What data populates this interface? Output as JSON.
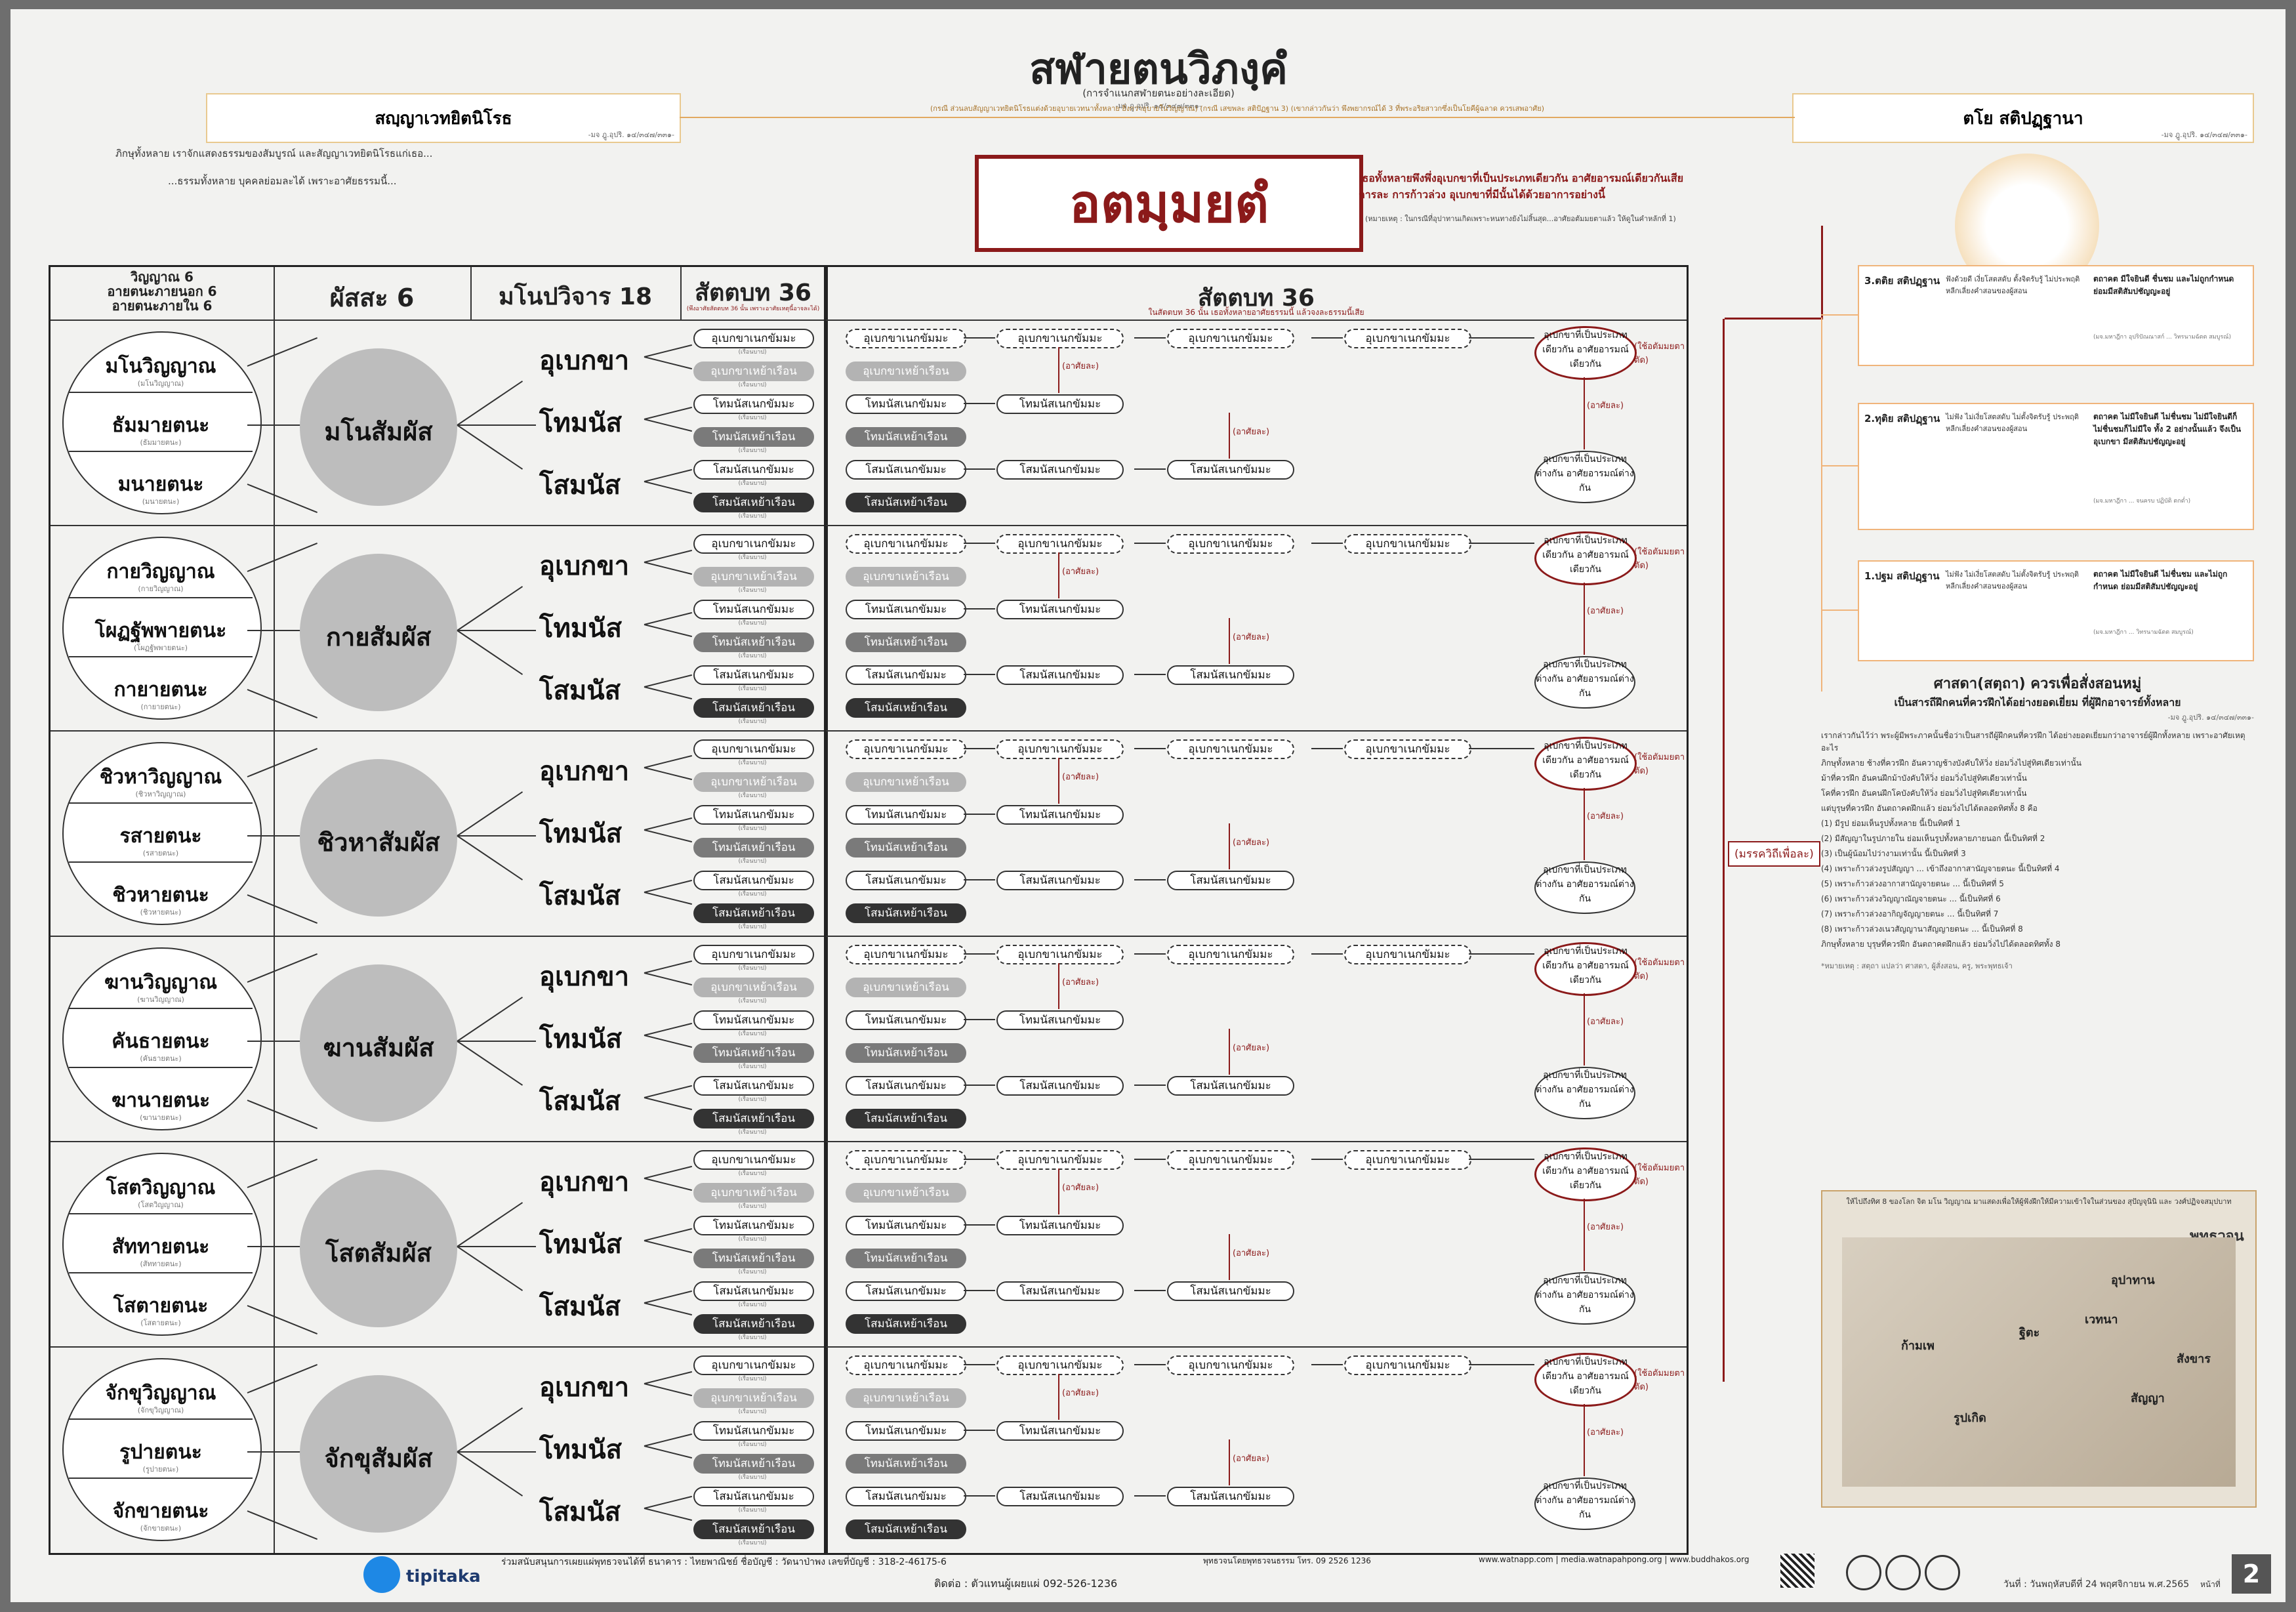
{
  "title": "สฬายตนวิภงฺคํ",
  "subtitle": "(การจำแนกสฬายตนะอย่างละเอียด)",
  "ref": "-มจ ฎู.อุปริ. ๑๔/๓๔๗/๓๓๑-",
  "hdr_left": {
    "title": "สญฺญาเวทยิตนิโรธ",
    "ref": "-มจ ฎู.อุปริ. ๑๔/๓๔๗/๓๓๑-"
  },
  "hdr_right": {
    "title": "ตโย สติปฏฺฐานา",
    "ref": "-มจ ฎู.อุปริ. ๑๔/๓๔๗/๓๓๑-"
  },
  "hdr_mid_text": "(กรณี ส่วนลบสัญญาเวทยิตนิโรธแต่งด้วยอุบายเวทนาทั้งหลาย ยิ่งกว่าอุบายในวิญญาณ) (กรณี เสขพละ สติปัฏฐาน 3) (เขากล่าวกันว่า พึงพยากรณ์ได้ 3 ที่พระอริยสาวกซึ่งเป็นโยคีผู้ฉลาด ควรเสพอาศัย)",
  "left_text_1": "ภิกษุทั้งหลาย เราจักแสดงธรรมของสัมบูรณ์ และสัญญาเวทยิตนิโรธแก่เธอ...",
  "left_text_2": "...ธรรมทั้งหลาย บุคคลย่อมละได้ เพราะอาศัยธรรมนี้...",
  "big_title": "อตมฺมยตํ",
  "red_note": "เธอทั้งหลายพึงพึ่งอุเบกขาที่เป็นประเภทเดียวกัน อาศัยอารมณ์เดียวกันเสีย การละ การก้าวล่วง อุเบกขาที่มีนั้นได้ด้วยอาการอย่างนี้",
  "note_small": "(หมายเหตุ : ในกรณีที่อุปาทานเกิดเพราะหนทางยังไม่สิ้นสุด...อาศัยอตัมมยตาแล้ว ให้ดูในคำหลักที่ 1)",
  "lt_headers": {
    "c1a": "วิญญาณ 6",
    "c1b": "อายตนะภายนอก 6",
    "c1c": "อายตนะภายใน 6",
    "c2": "ผัสสะ 6",
    "c3": "มโนปวิจาร 18",
    "c4": "สัตตบท 36",
    "c4_sub": "(พึงอาศัยสัตตบท 36 นั้น เพราะอาศัยเหตุนี้อาจละได้)"
  },
  "rt_header": "สัตตบท 36",
  "rt_header_sub": "ในสัตตบท 36 นั้น เธอทั้งหลายอาศัยธรรมนี้ แล้วจงละธรรมนี้เสีย",
  "vicara": [
    "อุเบกขา",
    "โทมนัส",
    "โสมนัส"
  ],
  "pills_left": [
    "อุเบกขาเนกขัมมะ",
    "อุเบกขาเหย้าเรือน",
    "โทมนัสเนกขัมมะ",
    "โทมนัสเหย้าเรือน",
    "โสมนัสเนกขัมมะ",
    "โสมนัสเหย้าเรือน"
  ],
  "pill_sub": "(เรือนบาป)",
  "group_labels": {
    "pure": "(อริยปุถุชน)",
    "attach": "(อาศัยละ)"
  },
  "chain": {
    "u1": "อุเบกขาเนกขัมมะ",
    "u2": "อุเบกขาเนกขัมมะ",
    "u3": "อุเบกขาเนกขัมมะ",
    "d": "โทมนัสเนกขัมมะ",
    "s1": "โสมนัสเนกขัมมะ",
    "s2": "โสมนัสเนกขัมมะ",
    "red_top": "อุเบกขาที่เป็นประเภทเดียวกัน อาศัยอารมณ์เดียวกัน",
    "red_bot": "อุเบกขาที่เป็นประเภทต่างกัน อาศัยอารมณ์ต่างกัน",
    "red_label": "(ใช้อตัมมยตาตัด)"
  },
  "marga_label": "(มรรควิถีเพื่อละ)",
  "rows": [
    {
      "sense": [
        "มโนวิญญาณ",
        "ธัมมายตนะ",
        "มนายตนะ"
      ],
      "subs": [
        "(มโนวิญญาณ)",
        "(ธัมมายตนะ)",
        "(มนายตนะ)"
      ],
      "phassa": "มโนสัมผัส"
    },
    {
      "sense": [
        "กายวิญญาณ",
        "โผฏฐัพพายตนะ",
        "กายายตนะ"
      ],
      "subs": [
        "(กายวิญญาณ)",
        "(โผฏฐัพพายตนะ)",
        "(กายายตนะ)"
      ],
      "phassa": "กายสัมผัส"
    },
    {
      "sense": [
        "ชิวหาวิญญาณ",
        "รสายตนะ",
        "ชิวหายตนะ"
      ],
      "subs": [
        "(ชิวหาวิญญาณ)",
        "(รสายตนะ)",
        "(ชิวหายตนะ)"
      ],
      "phassa": "ชิวหาสัมผัส"
    },
    {
      "sense": [
        "ฆานวิญญาณ",
        "คันธายตนะ",
        "ฆานายตนะ"
      ],
      "subs": [
        "(ฆานวิญญาณ)",
        "(คันธายตนะ)",
        "(ฆานายตนะ)"
      ],
      "phassa": "ฆานสัมผัส"
    },
    {
      "sense": [
        "โสตวิญญาณ",
        "สัททายตนะ",
        "โสตายตนะ"
      ],
      "subs": [
        "(โสตวิญญาณ)",
        "(สัททายตนะ)",
        "(โสตายตนะ)"
      ],
      "phassa": "โสตสัมผัส"
    },
    {
      "sense": [
        "จักขุวิญญาณ",
        "รูปายตนะ",
        "จักขายตนะ"
      ],
      "subs": [
        "(จักขุวิญญาณ)",
        "(รูปายตนะ)",
        "(จักขายตนะ)"
      ],
      "phassa": "จักขุสัมผัส"
    }
  ],
  "panels": [
    {
      "title": "3.ตติย สติปฏฺฐาน",
      "a": "ฟังด้วยดี เงี่ยโสตสดับ ตั้งจิตรับรู้ ไม่ประพฤติหลีกเลี่ยงคำสอนของผู้สอน",
      "b": "ตถาคต มีใจยินดี ชื่นชม และไม่ถูกกำหนด ย่อมมีสติสัมปชัญญะอยู่",
      "ref": "(มจ.มหาฎีกา อุปริปัณณาสก์ ... วิทรนามฉัตต สมบูรณ์)"
    },
    {
      "title": "2.ทุติย สติปฏฺฐาน",
      "a": "ไม่ฟัง ไม่เงี่ยโสตสดับ ไม่ตั้งจิตรับรู้ ประพฤติหลีกเลี่ยงคำสอนของผู้สอน",
      "b": "ตถาคต ไม่มีใจยินดี ไม่ชื่นชม ไม่มีใจยินดีก็ไม่ชื่นชมก็ไม่มีใจ ทั้ง 2 อย่างนั้นแล้ว จึงเป็นอุเบกขา มีสติสัมปชัญญะอยู่",
      "ref": "(มจ.มหาฎีกา ... จนครบ ปฏิบัติ ตกต่ำ)"
    },
    {
      "title": "1.ปฐม สติปฏฺฐาน",
      "a": "ไม่ฟัง ไม่เงี่ยโสตสดับ ไม่ตั้งจิตรับรู้ ประพฤติหลีกเลี่ยงคำสอนของผู้สอน",
      "b": "ตถาคต ไม่มีใจยินดี ไม่ชื่นชม และไม่ถูกกำหนด ย่อมมีสติสัมปชัญญะอยู่",
      "ref": "(มจ.มหาฎีกา ... วิทรนามฉัตต สมบูรณ์)"
    }
  ],
  "teacher_title": "ศาสดา(สตฺถา) ควรเพื่อสั่งสอนหมู่",
  "teacher_sub": "เป็นสารถีฝึกคนที่ควรฝึกได้อย่างยอดเยี่ยม ที่ผู้ฝึกอาจารย์ทั้งหลาย",
  "teacher_ref": "-มจ ฎู.อุปริ. ๑๔/๓๔๗/๓๓๑-",
  "teacher_body": [
    "เรากล่าวกันไว้ว่า พระผู้มีพระภาคนั้นชื่อว่าเป็นสารถีผู้ฝึกคนที่ควรฝึก ได้อย่างยอดเยี่ยมกว่าอาจารย์ผู้ฝึกทั้งหลาย เพราะอาศัยเหตุอะไร",
    "ภิกษุทั้งหลาย ช้างที่ควรฝึก อันควาญช้างบังคับให้วิ่ง ย่อมวิ่งไปสู่ทิศเดียวเท่านั้น",
    "ม้าที่ควรฝึก อันคนฝึกม้าบังคับให้วิ่ง ย่อมวิ่งไปสู่ทิศเดียวเท่านั้น",
    "โคที่ควรฝึก อันคนฝึกโคบังคับให้วิ่ง ย่อมวิ่งไปสู่ทิศเดียวเท่านั้น",
    "แต่บุรุษที่ควรฝึก อันตถาคตฝึกแล้ว ย่อมวิ่งไปได้ตลอดทิศทั้ง 8 คือ",
    "(1) มีรูป ย่อมเห็นรูปทั้งหลาย นี้เป็นทิศที่ 1",
    "(2) มีสัญญาในรูปภายใน ย่อมเห็นรูปทั้งหลายภายนอก นี้เป็นทิศที่ 2",
    "(3) เป็นผู้น้อมไปว่างามเท่านั้น นี้เป็นทิศที่ 3",
    "(4) เพราะก้าวล่วงรูปสัญญา ... เข้าถึงอากาสานัญจายตนะ นี้เป็นทิศที่ 4",
    "(5) เพราะก้าวล่วงอากาสานัญจายตนะ ... นี้เป็นทิศที่ 5",
    "(6) เพราะก้าวล่วงวิญญาณัญจายตนะ ... นี้เป็นทิศที่ 6",
    "(7) เพราะก้าวล่วงอากิญจัญญายตนะ ... นี้เป็นทิศที่ 7",
    "(8) เพราะก้าวล่วงเนวสัญญานาสัญญายตนะ ... นี้เป็นทิศที่ 8",
    "ภิกษุทั้งหลาย บุรุษที่ควรฝึก อันตถาคตฝึกแล้ว ย่อมวิ่งไปได้ตลอดทิศทั้ง 8"
  ],
  "teacher_note": "*หมายเหตุ : สตฺถา แปลว่า ศาสดา, ผู้สั่งสอน, ครู, พระพุทธเจ้า",
  "photo_caption": "ให้ไปถึงทิศ 8 ของโลก จิต มโน วิญญาณ มาแสดงเพื่อให้ผู้ฟังฝึกให้มีความเข้าใจในส่วนของ สุปัญจุนินิ และ วงศ์ปฏิจจสมุปบาท",
  "photo_label": "พุทธวจน",
  "photo_words": [
    "ก้ามเพ",
    "รูปเกิด",
    "ฐิตะ",
    "เวทนา",
    "สัญญา",
    "อุปาทาน",
    "สังขาร"
  ],
  "footer_sponsor": "ร่วมสนับสนุนการเผยแผ่พุทธวจนได้ที่ ธนาคาร : ไทยพาณิชย์ ชื่อบัญชี : วัดนาป่าพง เลขที่บัญชี : 318-2-46175-6",
  "footer_tel": "ติดต่อ : ตัวแทนผู้เผยแผ่ 092-526-1236",
  "footer_text2": "พุทธวจนโดยพุทธวจนธรรม โทร. 09 2526 1236",
  "footer_web": "www.watnapp.com | media.watnapahpong.org | www.buddhakos.org",
  "footer_brand": "tipitaka",
  "footer_date": "วันที่ : วันพฤหัสบดีที่ 24 พฤศจิกายน พ.ศ.2565",
  "page_label": "หน้าที่",
  "page_num": "2",
  "colors": {
    "red": "#8b1a1a",
    "gray_circle": "#bdbdbd",
    "orange": "#f0b47a"
  }
}
